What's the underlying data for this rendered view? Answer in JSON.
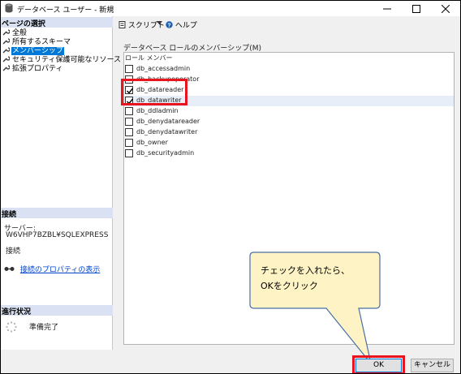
{
  "window": {
    "title": "データベース ユーザー - 新規"
  },
  "sidebar": {
    "header": "ページの選択",
    "items": [
      {
        "label": "全般"
      },
      {
        "label": "所有するスキーマ"
      },
      {
        "label": "メンバーシップ",
        "selected": true
      },
      {
        "label": "セキュリティ保護可能なリソース"
      },
      {
        "label": "拡張プロパティ"
      }
    ]
  },
  "connection": {
    "header": "接続",
    "server_label": "サーバー:",
    "server_value": "W6VHP7BZBL¥SQLEXPRESS",
    "connection_label": "接続",
    "link": "接続のプロパティの表示"
  },
  "progress": {
    "header": "進行状況",
    "status": "準備完了"
  },
  "toolbar": {
    "script": "スクリプト",
    "help": "ヘルプ"
  },
  "membership": {
    "group_label": "データベース ロールのメンバーシップ(M)",
    "column_header": "ロール メンバー",
    "roles": [
      {
        "name": "db_accessadmin",
        "checked": false
      },
      {
        "name": "db_backupoperator",
        "checked": false
      },
      {
        "name": "db_datareader",
        "checked": true
      },
      {
        "name": "db_datawriter",
        "checked": true
      },
      {
        "name": "db_ddladmin",
        "checked": false
      },
      {
        "name": "db_denydatareader",
        "checked": false
      },
      {
        "name": "db_denydatawriter",
        "checked": false
      },
      {
        "name": "db_owner",
        "checked": false
      },
      {
        "name": "db_securityadmin",
        "checked": false
      }
    ]
  },
  "callout": {
    "text": "チェックを入れたら、\nOKをクリック"
  },
  "buttons": {
    "ok": "OK",
    "cancel": "キャンセル"
  },
  "colors": {
    "highlight_border": "#e8141e",
    "callout_fill": "#fdf3c4",
    "callout_stroke": "#4a6fa5",
    "selection_blue": "#0078d7",
    "section_header": "#d9e1f2"
  }
}
